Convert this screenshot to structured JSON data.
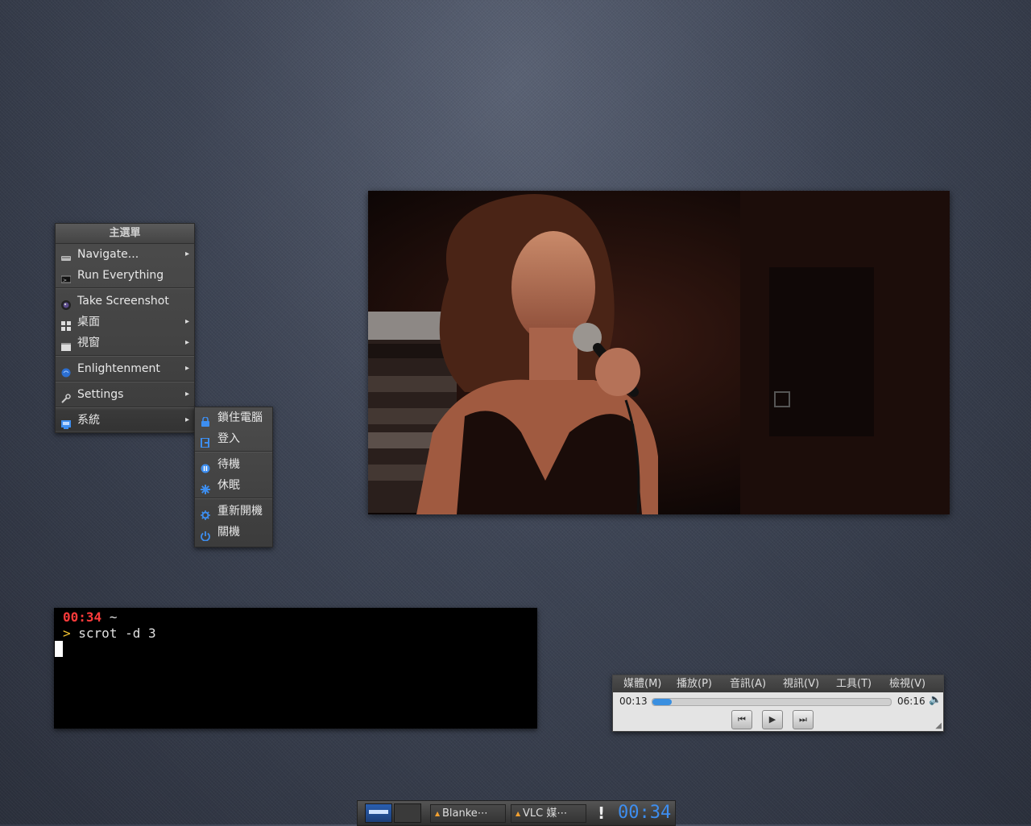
{
  "main_menu": {
    "title": "主選單",
    "items": [
      {
        "label": "Navigate...",
        "icon": "drive-icon",
        "submenu": true
      },
      {
        "label": "Run Everything",
        "icon": "terminal-icon",
        "submenu": false
      },
      {
        "label": "Take Screenshot",
        "icon": "camera-icon",
        "submenu": false
      },
      {
        "label": "桌面",
        "icon": "desktop-icon",
        "submenu": true
      },
      {
        "label": "視窗",
        "icon": "window-icon",
        "submenu": true
      },
      {
        "label": "Enlightenment",
        "icon": "enlightenment-icon",
        "submenu": true
      },
      {
        "label": "Settings",
        "icon": "wrench-icon",
        "submenu": true
      },
      {
        "label": "系統",
        "icon": "system-icon",
        "submenu": true
      }
    ]
  },
  "system_menu": {
    "items": [
      {
        "label": "鎖住電腦",
        "icon": "lock-icon"
      },
      {
        "label": "登入",
        "icon": "logout-icon"
      },
      {
        "label": "待機",
        "icon": "suspend-icon"
      },
      {
        "label": "休眠",
        "icon": "hibernate-icon"
      },
      {
        "label": "重新開機",
        "icon": "reboot-icon"
      },
      {
        "label": "關機",
        "icon": "power-icon"
      }
    ]
  },
  "terminal": {
    "time": "00:34",
    "cwd": "~",
    "prompt": ">",
    "command": "scrot -d 3"
  },
  "vlc": {
    "menus": [
      "媒體(M)",
      "播放(P)",
      "音訊(A)",
      "視訊(V)",
      "工具(T)",
      "檢視(V)"
    ],
    "elapsed": "00:13",
    "duration": "06:16",
    "progress": 0.035
  },
  "taskbar": {
    "tasks": [
      "Blanke⋯",
      "VLC 媒⋯"
    ],
    "clock": "00:34"
  },
  "colors": {
    "accent": "#3d8ef0",
    "terminal_time": "#ff3b3b",
    "terminal_prompt": "#f2c230"
  }
}
